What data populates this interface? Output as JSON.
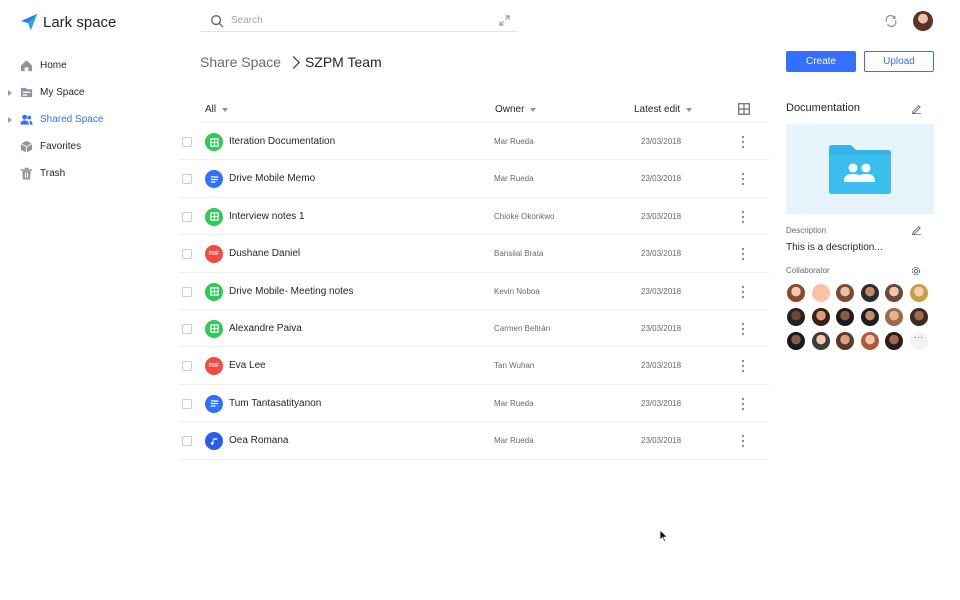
{
  "app": {
    "title": "Lark space"
  },
  "search": {
    "placeholder": "Search"
  },
  "sidebar": {
    "items": [
      {
        "label": "Home",
        "icon": "home-icon"
      },
      {
        "label": "My Space",
        "icon": "folder-icon"
      },
      {
        "label": "Shared Space",
        "icon": "users-icon",
        "active": true
      },
      {
        "label": "Favorites",
        "icon": "box-icon"
      },
      {
        "label": "Trash",
        "icon": "trash-icon"
      }
    ]
  },
  "breadcrumb": {
    "root": "Share Space",
    "current": "SZPM Team"
  },
  "actions": {
    "create": "Create",
    "upload": "Upload"
  },
  "table": {
    "columns": {
      "name": "All",
      "owner": "Owner",
      "edited": "Latest edit"
    },
    "rows": [
      {
        "name": "Iteration Documentation",
        "owner": "Mar Rueda",
        "date": "23/03/2018",
        "type": "sheet",
        "type_color": "#34c759"
      },
      {
        "name": "Drive Mobile Memo",
        "owner": "Mar Rueda",
        "date": "23/03/2018",
        "type": "doc",
        "type_color": "#3370ff"
      },
      {
        "name": "Interview notes 1",
        "owner": "Chioke Okonkwo",
        "date": "23/03/2018",
        "type": "sheet",
        "type_color": "#34c759"
      },
      {
        "name": "Dushane Daniel",
        "owner": "Bansilal Brata",
        "date": "23/03/2018",
        "type": "pdf",
        "type_color": "#f54a45",
        "badge": "PDF"
      },
      {
        "name": "Drive Mobile- Meeting notes",
        "owner": "Kevin Noboa",
        "date": "23/03/2018",
        "type": "sheet",
        "type_color": "#34c759"
      },
      {
        "name": "Alexandre Paiva",
        "owner": "Carmen Beltrán",
        "date": "23/03/2018",
        "type": "sheet",
        "type_color": "#34c759"
      },
      {
        "name": "Eva Lee",
        "owner": "Tan Wuhan",
        "date": "23/03/2018",
        "type": "pdf",
        "type_color": "#f54a45",
        "badge": "PDF"
      },
      {
        "name": "Tum Tantasatityanon",
        "owner": "Mar Rueda",
        "date": "23/03/2018",
        "type": "doc",
        "type_color": "#3370ff"
      },
      {
        "name": "Oea Romana",
        "owner": "Mar Rueda",
        "date": "23/03/2018",
        "type": "audio",
        "type_color": "#2a5ee6"
      }
    ]
  },
  "panel": {
    "title": "Documentation",
    "description_label": "Description",
    "description": "This is a description...",
    "collaborator_label": "Collaborator",
    "more": "···"
  },
  "colors": {
    "accent": "#3370ff",
    "sheet": "#34c759",
    "pdf": "#f54a45",
    "folder": "#35b4e8"
  }
}
